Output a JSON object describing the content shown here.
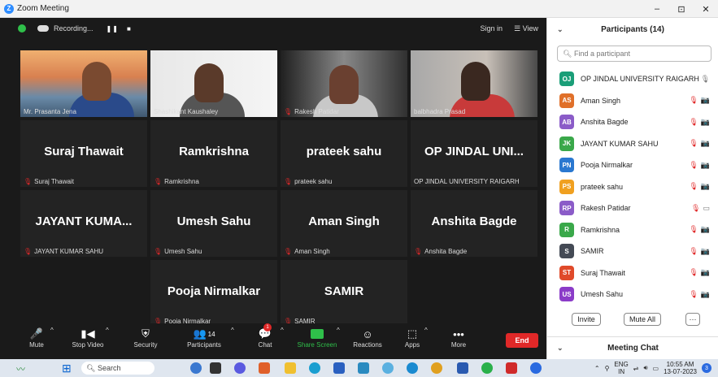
{
  "window": {
    "title": "Zoom Meeting",
    "controls": [
      "–",
      "⊡",
      "✕"
    ]
  },
  "topbar": {
    "recording_label": "Recording...",
    "sign_in": "Sign in",
    "view": "View"
  },
  "tiles": [
    {
      "big": "",
      "name": "Mr. Prasanta Jena",
      "muted": false
    },
    {
      "big": "",
      "name": "Shashikant Kaushaley",
      "muted": false
    },
    {
      "big": "",
      "name": "Rakesh Patidar",
      "muted": true
    },
    {
      "big": "",
      "name": "balbhadra Prasad",
      "muted": false
    },
    {
      "big": "Suraj Thawait",
      "name": "Suraj Thawait",
      "muted": true
    },
    {
      "big": "Ramkrishna",
      "name": "Ramkrishna",
      "muted": true
    },
    {
      "big": "prateek sahu",
      "name": "prateek sahu",
      "muted": true
    },
    {
      "big": "OP JINDAL UNI...",
      "name": "OP JINDAL UNIVERSITY RAIGARH",
      "muted": false
    },
    {
      "big": "JAYANT KUMA...",
      "name": "JAYANT KUMAR SAHU",
      "muted": true
    },
    {
      "big": "Umesh Sahu",
      "name": "Umesh Sahu",
      "muted": true
    },
    {
      "big": "Aman Singh",
      "name": "Aman Singh",
      "muted": true
    },
    {
      "big": "Anshita Bagde",
      "name": "Anshita Bagde",
      "muted": true
    },
    {
      "big": "Pooja Nirmalkar",
      "name": "Pooja Nirmalkar",
      "muted": true
    },
    {
      "big": "SAMIR",
      "name": "SAMIR",
      "muted": true
    }
  ],
  "toolbar": {
    "mute": "Mute",
    "stop_video": "Stop Video",
    "security": "Security",
    "participants": "Participants",
    "participants_count": "14",
    "chat": "Chat",
    "chat_badge": "1",
    "share_screen": "Share Screen",
    "reactions": "Reactions",
    "apps": "Apps",
    "more": "More",
    "end": "End"
  },
  "panel": {
    "title": "Participants (14)",
    "search_placeholder": "Find a participant",
    "participants": [
      {
        "initials": "OJ",
        "name": "OP JINDAL UNIVERSITY RAIGARH",
        "color": "#1a9e78"
      },
      {
        "initials": "AS",
        "name": "Aman Singh",
        "color": "#e0702a"
      },
      {
        "initials": "AB",
        "name": "Anshita Bagde",
        "color": "#8b5cc8"
      },
      {
        "initials": "JK",
        "name": "JAYANT KUMAR SAHU",
        "color": "#3aa84a"
      },
      {
        "initials": "PN",
        "name": "Pooja Nirmalkar",
        "color": "#2a78d0"
      },
      {
        "initials": "PS",
        "name": "prateek sahu",
        "color": "#f0a020"
      },
      {
        "initials": "RP",
        "name": "Rakesh Patidar",
        "color": "#8b5cc8"
      },
      {
        "initials": "R",
        "name": "Ramkrishna",
        "color": "#3aa84a"
      },
      {
        "initials": "S",
        "name": "SAMIR",
        "color": "#444a55"
      },
      {
        "initials": "ST",
        "name": "Suraj Thawait",
        "color": "#e04a2a"
      },
      {
        "initials": "US",
        "name": "Umesh Sahu",
        "color": "#8b3cc8"
      }
    ],
    "invite": "Invite",
    "mute_all": "Mute All",
    "more": "···",
    "chat_title": "Meeting Chat"
  },
  "taskbar": {
    "search": "Search",
    "lang_top": "ENG",
    "lang_bottom": "IN",
    "time": "10:55 AM",
    "date": "13-07-2023",
    "notif": "3"
  }
}
